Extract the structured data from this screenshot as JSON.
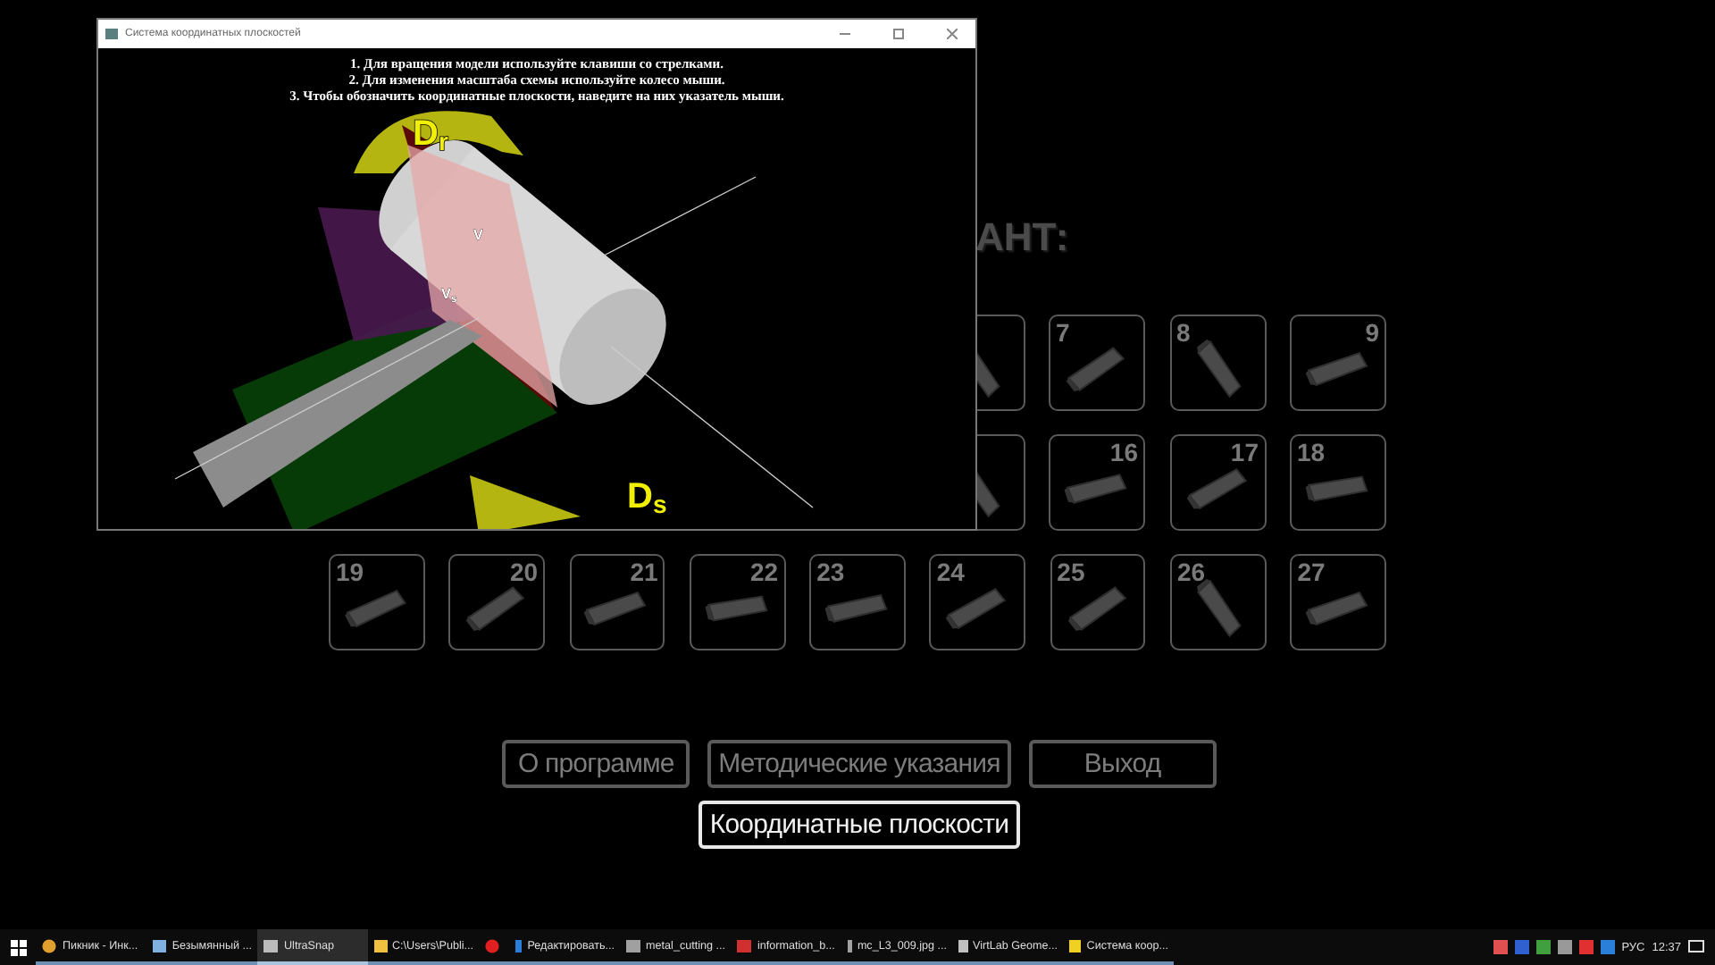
{
  "window": {
    "title": "Система координатных плоскостей",
    "instructions": [
      "1. Для вращения модели используйте клавиши со стрелками.",
      "2. Для изменения масштаба схемы используйте колесо мыши.",
      "3. Чтобы обозначить координатные плоскости, наведите на них указатель мыши."
    ],
    "scene_labels": [
      {
        "kind": "large",
        "main": "D",
        "sub": "r"
      },
      {
        "kind": "large",
        "main": "D",
        "sub": "s"
      },
      {
        "kind": "small",
        "main": "V"
      },
      {
        "kind": "small",
        "main": "V",
        "sub": "s"
      }
    ]
  },
  "heading": "АНТ:",
  "tile_rows": [
    {
      "tiles": [
        {
          "kind": "partial"
        },
        {
          "number": "7"
        },
        {
          "number": "8"
        },
        {
          "number": "9"
        }
      ]
    },
    {
      "tiles": [
        {
          "kind": "partial"
        },
        {
          "number": "16"
        },
        {
          "number": "17"
        },
        {
          "number": "18"
        }
      ]
    },
    {
      "tiles": [
        {
          "number": "19"
        },
        {
          "number": "20"
        },
        {
          "number": "21"
        },
        {
          "number": "22"
        },
        {
          "number": "23"
        },
        {
          "number": "24"
        },
        {
          "number": "25"
        },
        {
          "number": "26"
        },
        {
          "number": "27"
        }
      ]
    }
  ],
  "buttons": [
    [
      {
        "label": "О программе",
        "selected": false
      },
      {
        "label": "Методические указания",
        "selected": false
      },
      {
        "label": "Выход",
        "selected": false
      }
    ],
    [
      {
        "label": "Координатные плоскости",
        "selected": true
      }
    ]
  ],
  "taskbar": {
    "items": [
      {
        "kind": "round",
        "label": "Пикник - Инк...",
        "active": false
      },
      {
        "kind": "square",
        "label": "Безымянный ...",
        "active": false
      },
      {
        "kind": "square",
        "label": "UltraSnap",
        "active": true
      },
      {
        "kind": "square",
        "label": "C:\\Users\\Publi...",
        "active": false
      },
      {
        "kind": "round",
        "active": false
      },
      {
        "kind": "square",
        "label": "Редактировать...",
        "active": false
      },
      {
        "kind": "square",
        "label": "metal_cutting ...",
        "active": false
      },
      {
        "kind": "square",
        "label": "information_b...",
        "active": false
      },
      {
        "kind": "square",
        "label": "mc_L3_009.jpg ...",
        "active": false
      },
      {
        "kind": "square",
        "label": "VirtLab Geome...",
        "active": false
      },
      {
        "kind": "square",
        "label": "Система коор...",
        "active": false
      }
    ],
    "language": "РУС",
    "time": "12:37"
  }
}
